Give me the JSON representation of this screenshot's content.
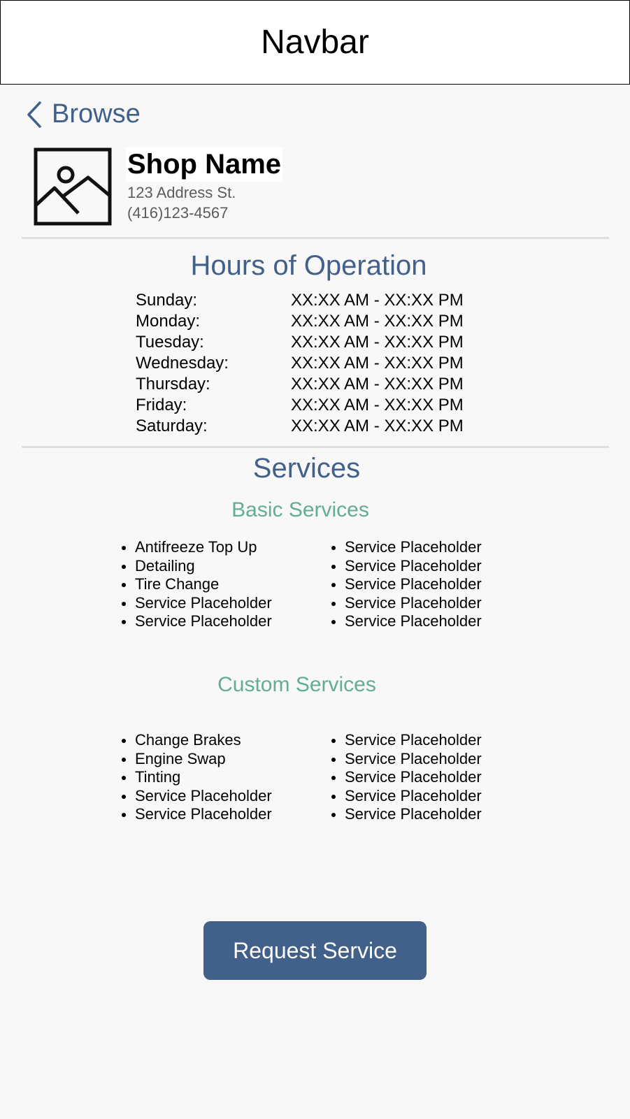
{
  "navbar": {
    "title": "Navbar"
  },
  "back": {
    "icon": "chevron-left-icon",
    "label": "Browse",
    "color": "#41608a"
  },
  "shop": {
    "image_icon": "image-placeholder-icon",
    "name": "Shop Name",
    "address": "123 Address St.",
    "phone": "(416)123-4567"
  },
  "hours": {
    "title": "Hours of Operation",
    "rows": [
      {
        "day": "Sunday:",
        "time": "XX:XX AM - XX:XX PM"
      },
      {
        "day": "Monday:",
        "time": "XX:XX AM - XX:XX PM"
      },
      {
        "day": "Tuesday:",
        "time": "XX:XX AM - XX:XX PM"
      },
      {
        "day": "Wednesday:",
        "time": "XX:XX AM - XX:XX PM"
      },
      {
        "day": "Thursday:",
        "time": "XX:XX AM - XX:XX PM"
      },
      {
        "day": "Friday:",
        "time": "XX:XX AM - XX:XX PM"
      },
      {
        "day": "Saturday:",
        "time": "XX:XX AM - XX:XX PM"
      }
    ]
  },
  "services": {
    "title": "Services",
    "basic": {
      "title": "Basic Services",
      "left": [
        "Antifreeze Top Up",
        "Detailing",
        "Tire Change",
        "Service Placeholder",
        "Service Placeholder"
      ],
      "right": [
        "Service Placeholder",
        "Service Placeholder",
        "Service Placeholder",
        "Service Placeholder",
        "Service Placeholder"
      ]
    },
    "custom": {
      "title": "Custom Services",
      "left": [
        "Change Brakes",
        "Engine Swap",
        "Tinting",
        "Service Placeholder",
        "Service Placeholder"
      ],
      "right": [
        "Service Placeholder",
        "Service Placeholder",
        "Service Placeholder",
        "Service Placeholder",
        "Service Placeholder"
      ]
    }
  },
  "actions": {
    "request_label": "Request Service"
  },
  "colors": {
    "primary": "#41608a",
    "accent": "#63ad92",
    "background": "#f8f8f8",
    "secondary_text": "#5c5c5c"
  }
}
